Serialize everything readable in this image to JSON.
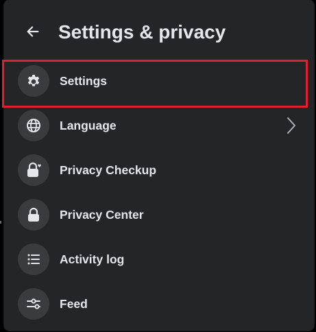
{
  "header": {
    "title": "Settings & privacy",
    "back_icon": "arrow-left-icon"
  },
  "menu": {
    "items": [
      {
        "label": "Settings",
        "icon": "gear-icon",
        "highlighted": true,
        "has_chevron": false
      },
      {
        "label": "Language",
        "icon": "globe-icon",
        "highlighted": false,
        "has_chevron": true
      },
      {
        "label": "Privacy Checkup",
        "icon": "lock-heart-icon",
        "highlighted": false,
        "has_chevron": false
      },
      {
        "label": "Privacy Center",
        "icon": "lock-icon",
        "highlighted": false,
        "has_chevron": false
      },
      {
        "label": "Activity log",
        "icon": "list-icon",
        "highlighted": false,
        "has_chevron": false
      },
      {
        "label": "Feed",
        "icon": "sliders-icon",
        "highlighted": false,
        "has_chevron": false
      }
    ]
  },
  "colors": {
    "panel_background": "#242526",
    "icon_circle": "#3a3b3c",
    "text": "#e4e6eb",
    "highlight_border": "#e2202f",
    "chevron": "#b0b3b8"
  }
}
